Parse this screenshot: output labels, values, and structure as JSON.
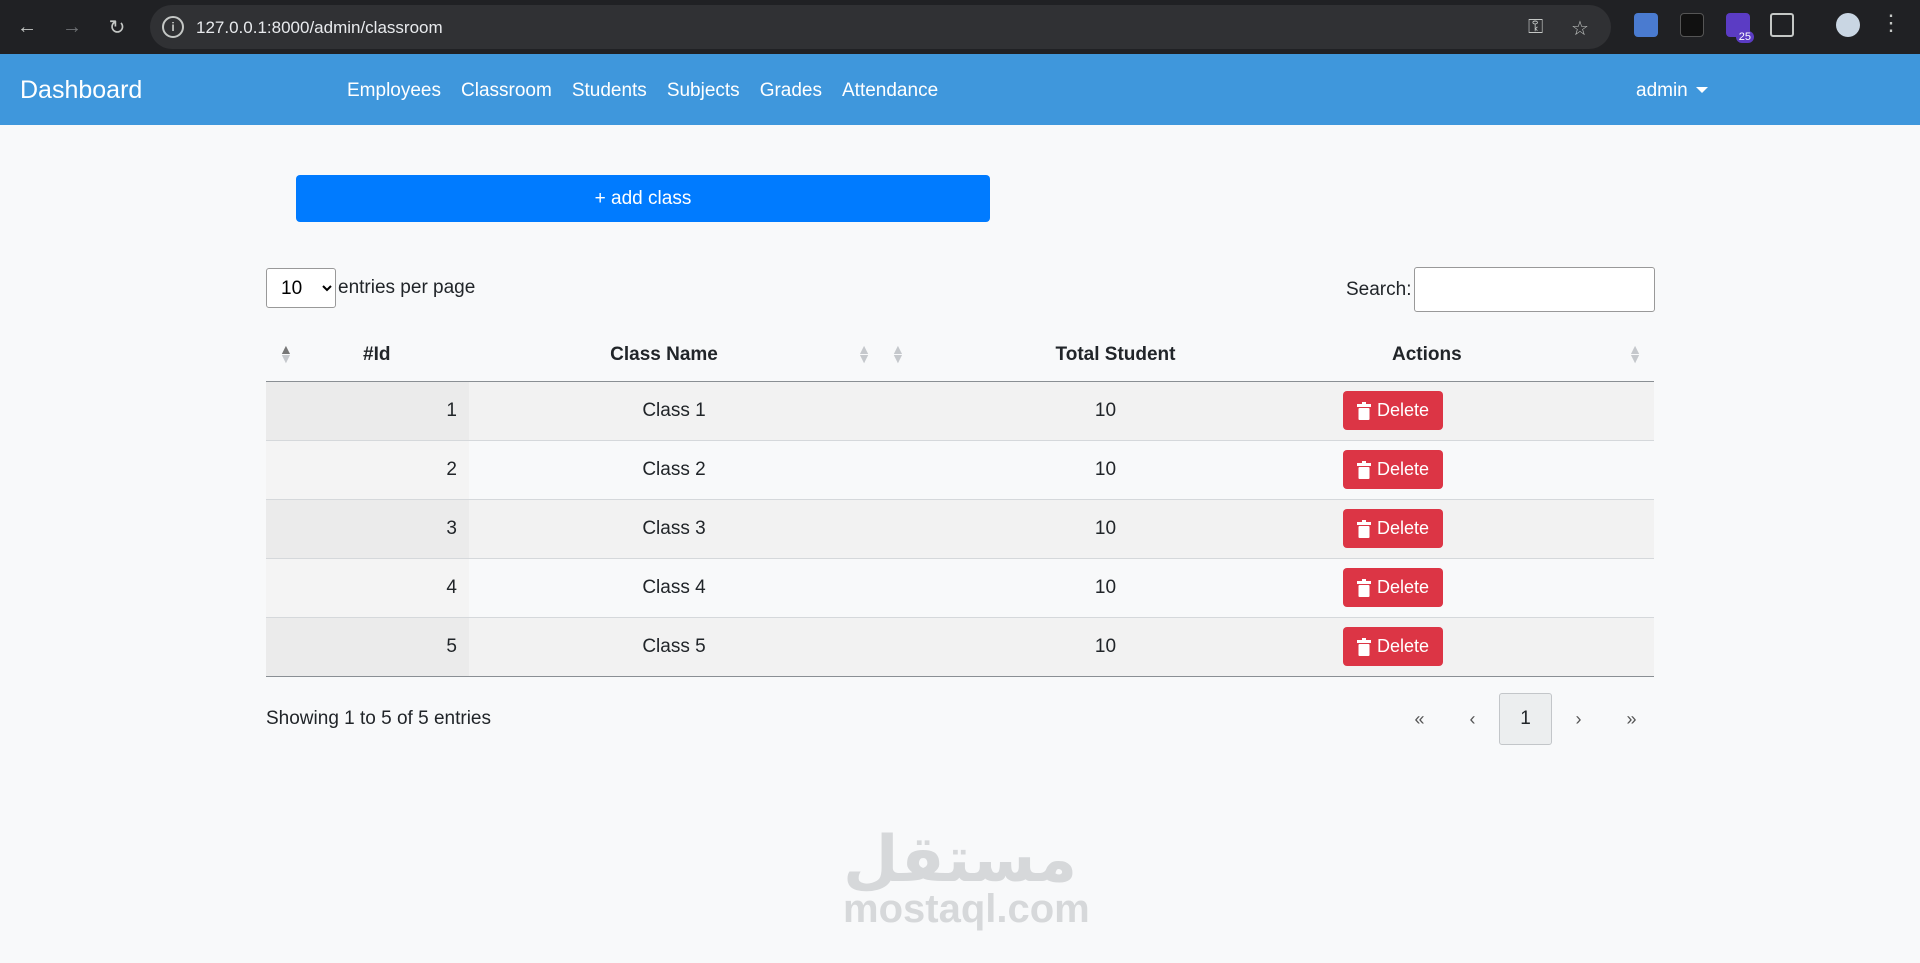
{
  "browser": {
    "url": "127.0.0.1:8000/admin/classroom",
    "extension_badge": "25"
  },
  "navbar": {
    "brand": "Dashboard",
    "links": [
      "Employees",
      "Classroom",
      "Students",
      "Subjects",
      "Grades",
      "Attendance"
    ],
    "user": "admin"
  },
  "page": {
    "add_button": "+ add class",
    "per_page_value": "10",
    "per_page_label": "entries per page",
    "search_label": "Search:",
    "search_value": ""
  },
  "table": {
    "columns": [
      "#Id",
      "Class Name",
      "Total Student",
      "Actions"
    ],
    "rows": [
      {
        "id": "1",
        "name": "Class 1",
        "total": "10",
        "action": "Delete"
      },
      {
        "id": "2",
        "name": "Class 2",
        "total": "10",
        "action": "Delete"
      },
      {
        "id": "3",
        "name": "Class 3",
        "total": "10",
        "action": "Delete"
      },
      {
        "id": "4",
        "name": "Class 4",
        "total": "10",
        "action": "Delete"
      },
      {
        "id": "5",
        "name": "Class 5",
        "total": "10",
        "action": "Delete"
      }
    ]
  },
  "footer": {
    "info": "Showing 1 to 5 of 5 entries",
    "pager": {
      "first": "«",
      "prev": "‹",
      "current": "1",
      "next": "›",
      "last": "»"
    }
  },
  "watermark": {
    "arabic": "مستقل",
    "latin": "mostaql.com"
  },
  "colors": {
    "navbar": "#3f97dc",
    "primary": "#007bff",
    "danger": "#dc3545"
  }
}
